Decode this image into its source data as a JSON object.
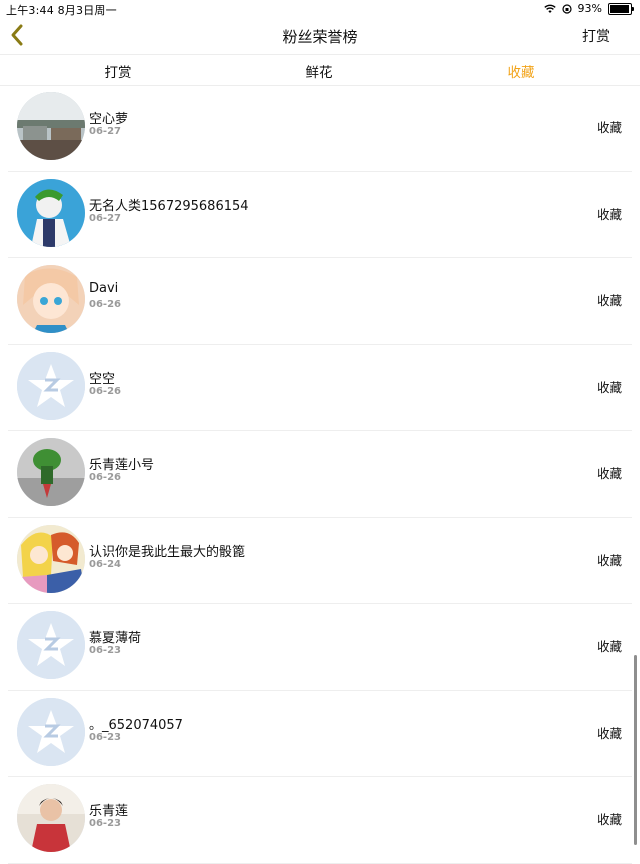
{
  "status_bar": {
    "time_date": "上午3:44   8月3日周一",
    "battery": "93%",
    "battery_level": 0.93
  },
  "nav": {
    "title": "粉丝荣誉榜",
    "right_action": "打赏"
  },
  "tabs": [
    {
      "label": "打赏",
      "active": false
    },
    {
      "label": "鲜花",
      "active": false
    },
    {
      "label": "收藏",
      "active": true
    }
  ],
  "colors": {
    "accent": "#f2a318",
    "back_icon": "#8a7b15"
  },
  "rows": [
    {
      "name": "空心萝",
      "date": "06-27",
      "action": "收藏",
      "avatar": "photo-landscape"
    },
    {
      "name": "无名人类1567295686154",
      "date": "06-27",
      "action": "收藏",
      "avatar": "photo-anime-green-hair"
    },
    {
      "name": "Davi",
      "date": "06-26",
      "action": "收藏",
      "avatar": "photo-anime-girl"
    },
    {
      "name": "空空",
      "date": "06-26",
      "action": "收藏",
      "avatar": "default-star"
    },
    {
      "name": "乐青莲小号",
      "date": "06-26",
      "action": "收藏",
      "avatar": "photo-green-figure"
    },
    {
      "name": "认识你是我此生最大的骰篦",
      "date": "06-24",
      "action": "收藏",
      "avatar": "photo-anime-couple"
    },
    {
      "name": "慕夏薄荷",
      "date": "06-23",
      "action": "收藏",
      "avatar": "default-star"
    },
    {
      "name": "。_652074057",
      "date": "06-23",
      "action": "收藏",
      "avatar": "default-star"
    },
    {
      "name": "乐青莲",
      "date": "06-23",
      "action": "收藏",
      "avatar": "photo-child"
    }
  ]
}
